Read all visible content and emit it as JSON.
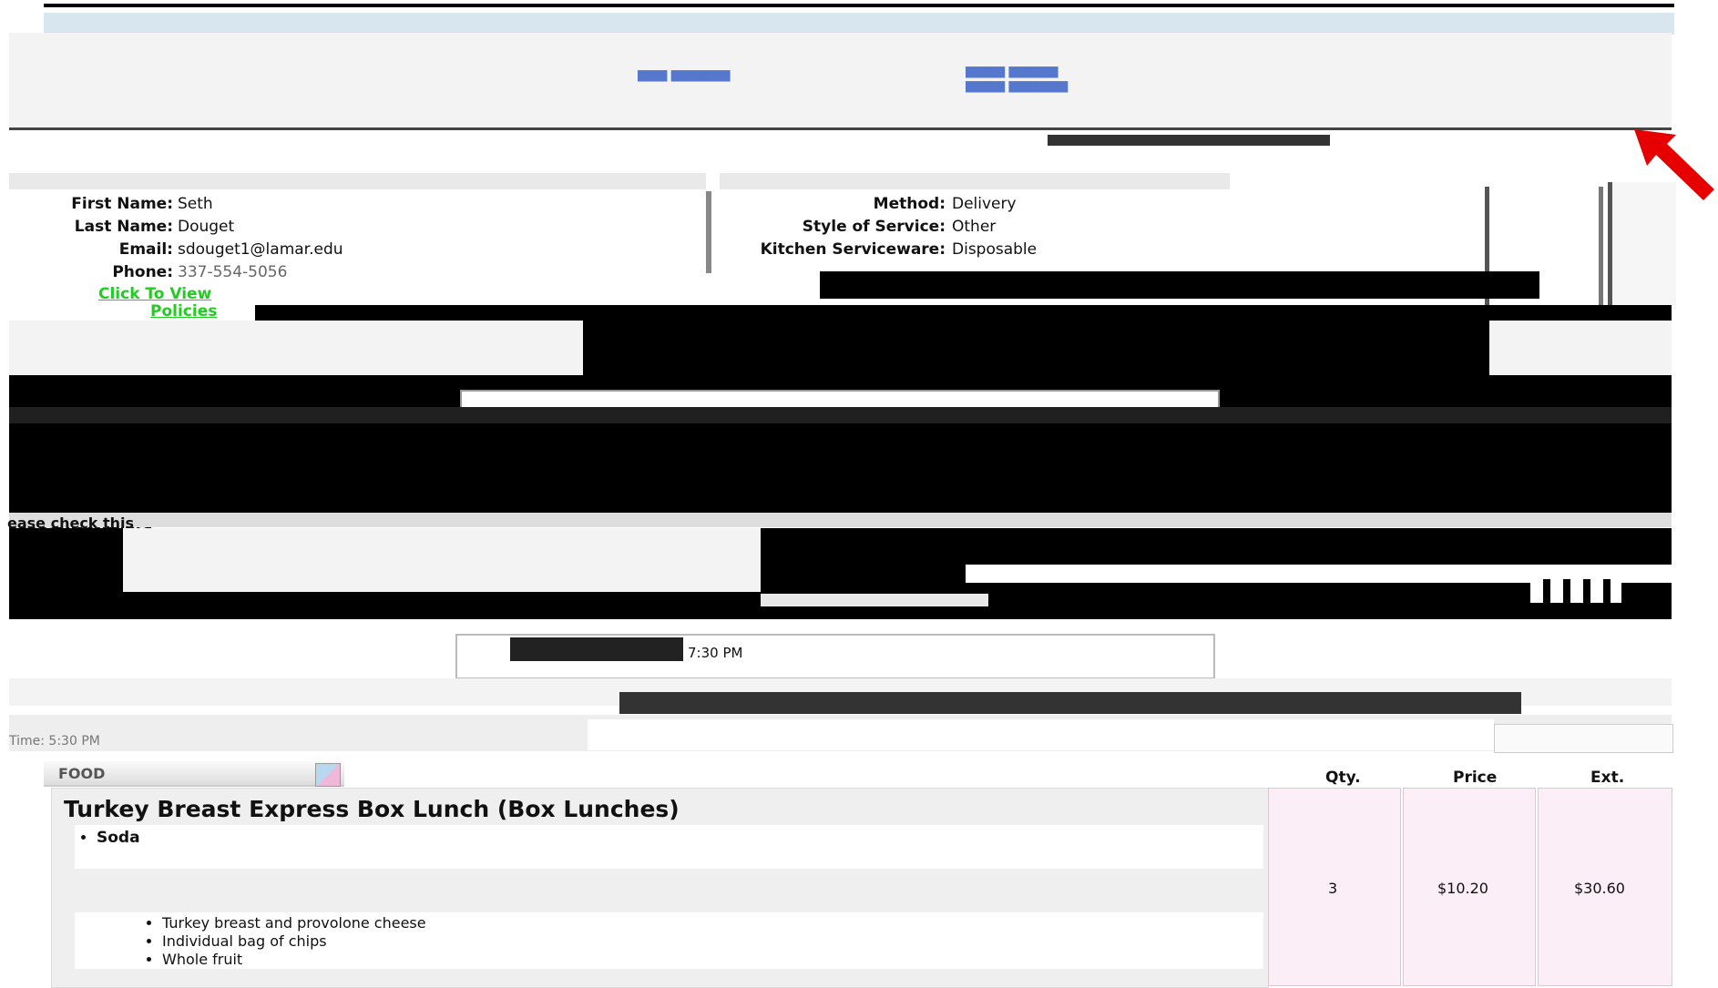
{
  "contact": {
    "first_name_label": "First Name:",
    "first_name": "Seth",
    "last_name_label": "Last Name:",
    "last_name": "Douget",
    "email_label": "Email:",
    "email": "sdouget1@lamar.edu",
    "phone_label": "Phone:",
    "phone": "337-554-5056",
    "click_to_view": "Click To View",
    "policies": "Policies"
  },
  "delivery": {
    "method_label": "Method:",
    "method": "Delivery",
    "style_label": "Style of Service:",
    "style": "Other",
    "kitchen_label": "Kitchen Serviceware:",
    "kitchen": "Disposable"
  },
  "notes": {
    "please_check": "ease check this"
  },
  "event": {
    "end_time_value": "7:30 PM",
    "time_value": "Time: 5:30 PM"
  },
  "order": {
    "section_label": "FOOD",
    "columns": {
      "qty": "Qty.",
      "price": "Price",
      "ext": "Ext."
    },
    "item_title": "Turkey Breast Express Box Lunch (Box Lunches)",
    "options": [
      "Soda"
    ],
    "description": [
      "Turkey breast and provolone cheese",
      "Individual bag of chips",
      "Whole fruit"
    ],
    "qty": "3",
    "price": "$10.20",
    "ext": "$30.60"
  },
  "colors": {
    "link": "#22cc22",
    "arrow": "#e60000",
    "pink": "#fbeef6"
  }
}
